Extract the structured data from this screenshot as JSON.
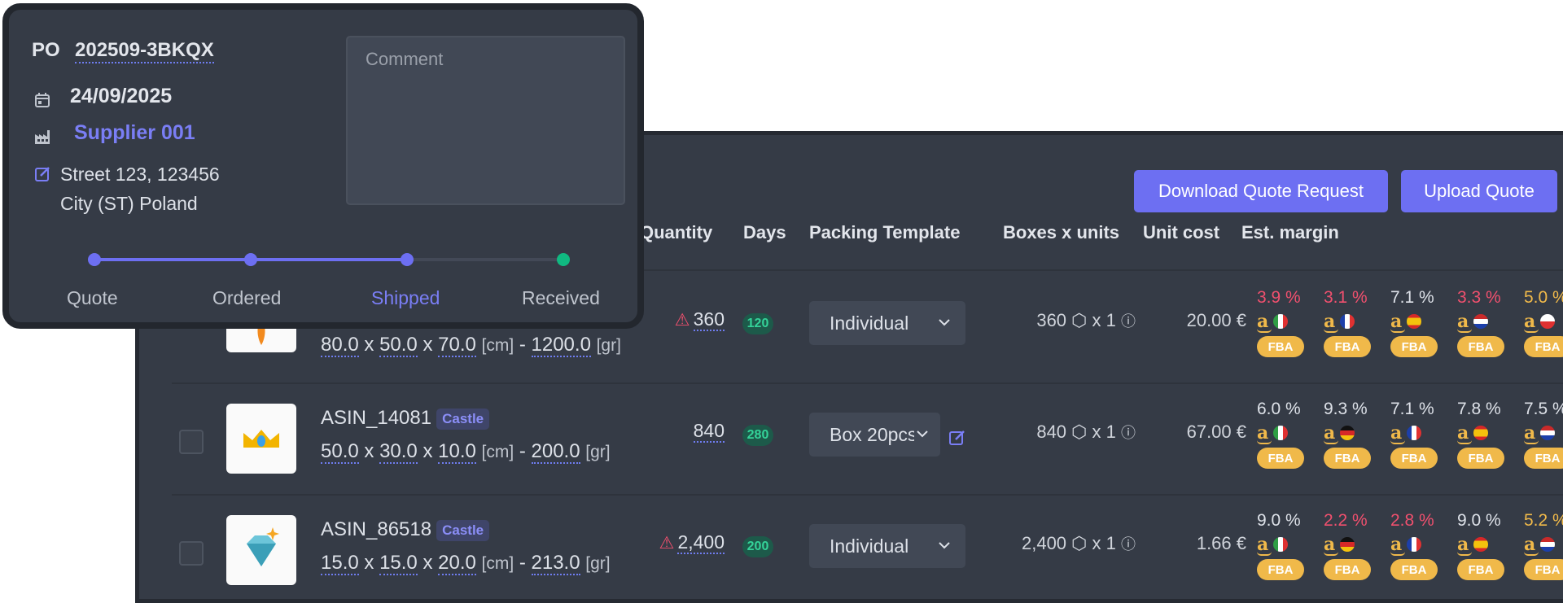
{
  "actions": {
    "download_label": "Download Quote Request",
    "upload_label": "Upload Quote"
  },
  "columns": [
    "Quantity",
    "Days",
    "Packing Template",
    "Boxes x units",
    "Unit cost",
    "Est. margin"
  ],
  "units": {
    "length": "[cm]",
    "weight": "[gr]"
  },
  "colors": {
    "accent": "#6d6ff2",
    "fba": "#f0b94a",
    "negative": "#f0506e",
    "days": "#34d399"
  },
  "rows": [
    {
      "asin": "",
      "tag": "",
      "dims": [
        "80.0",
        "50.0",
        "70.0"
      ],
      "weight": "1200.0",
      "qty_warning": true,
      "quantity": "360",
      "days": "120",
      "packing": "Individual",
      "box_qty": "360",
      "units_per_box": "x 1",
      "unit_cost": "20.00 €",
      "image": "carrot-icon",
      "margins": [
        {
          "pct": "3.9 %",
          "tone": "red",
          "flag": "it"
        },
        {
          "pct": "3.1 %",
          "tone": "red",
          "flag": "fr"
        },
        {
          "pct": "7.1 %",
          "tone": "white",
          "flag": "es"
        },
        {
          "pct": "3.3 %",
          "tone": "red",
          "flag": "nl"
        },
        {
          "pct": "5.0 %",
          "tone": "yellow",
          "flag": "pl"
        }
      ]
    },
    {
      "asin": "ASIN_14081",
      "tag": "Castle",
      "dims": [
        "50.0",
        "30.0",
        "10.0"
      ],
      "weight": "200.0",
      "qty_warning": false,
      "quantity": "840",
      "days": "280",
      "packing": "Box 20pcs",
      "box_qty": "840",
      "units_per_box": "x 1",
      "unit_cost": "67.00 €",
      "image": "crown-icon",
      "margins": [
        {
          "pct": "6.0 %",
          "tone": "white",
          "flag": "it"
        },
        {
          "pct": "9.3 %",
          "tone": "white",
          "flag": "de"
        },
        {
          "pct": "7.1 %",
          "tone": "white",
          "flag": "fr"
        },
        {
          "pct": "7.8 %",
          "tone": "white",
          "flag": "es"
        },
        {
          "pct": "7.5 %",
          "tone": "white",
          "flag": "nl"
        }
      ]
    },
    {
      "asin": "ASIN_86518",
      "tag": "Castle",
      "dims": [
        "15.0",
        "15.0",
        "20.0"
      ],
      "weight": "213.0",
      "qty_warning": true,
      "quantity": "2,400",
      "days": "200",
      "packing": "Individual",
      "box_qty": "2,400",
      "units_per_box": "x 1",
      "unit_cost": "1.66 €",
      "image": "diamond-icon",
      "margins": [
        {
          "pct": "9.0 %",
          "tone": "white",
          "flag": "it"
        },
        {
          "pct": "2.2 %",
          "tone": "red",
          "flag": "de"
        },
        {
          "pct": "2.8 %",
          "tone": "red",
          "flag": "fr"
        },
        {
          "pct": "9.0 %",
          "tone": "white",
          "flag": "es"
        },
        {
          "pct": "5.2 %",
          "tone": "yellow",
          "flag": "nl"
        }
      ]
    }
  ],
  "fba_label": "FBA",
  "po": {
    "label": "PO",
    "number": "202509-3BKQX",
    "date": "24/09/2025",
    "supplier": "Supplier 001",
    "address_line1": "Street 123, 123456",
    "address_line2": "City (ST) Poland",
    "comment_placeholder": "Comment",
    "steps": [
      "Quote",
      "Ordered",
      "Shipped",
      "Received"
    ],
    "current_step": "Shipped"
  }
}
